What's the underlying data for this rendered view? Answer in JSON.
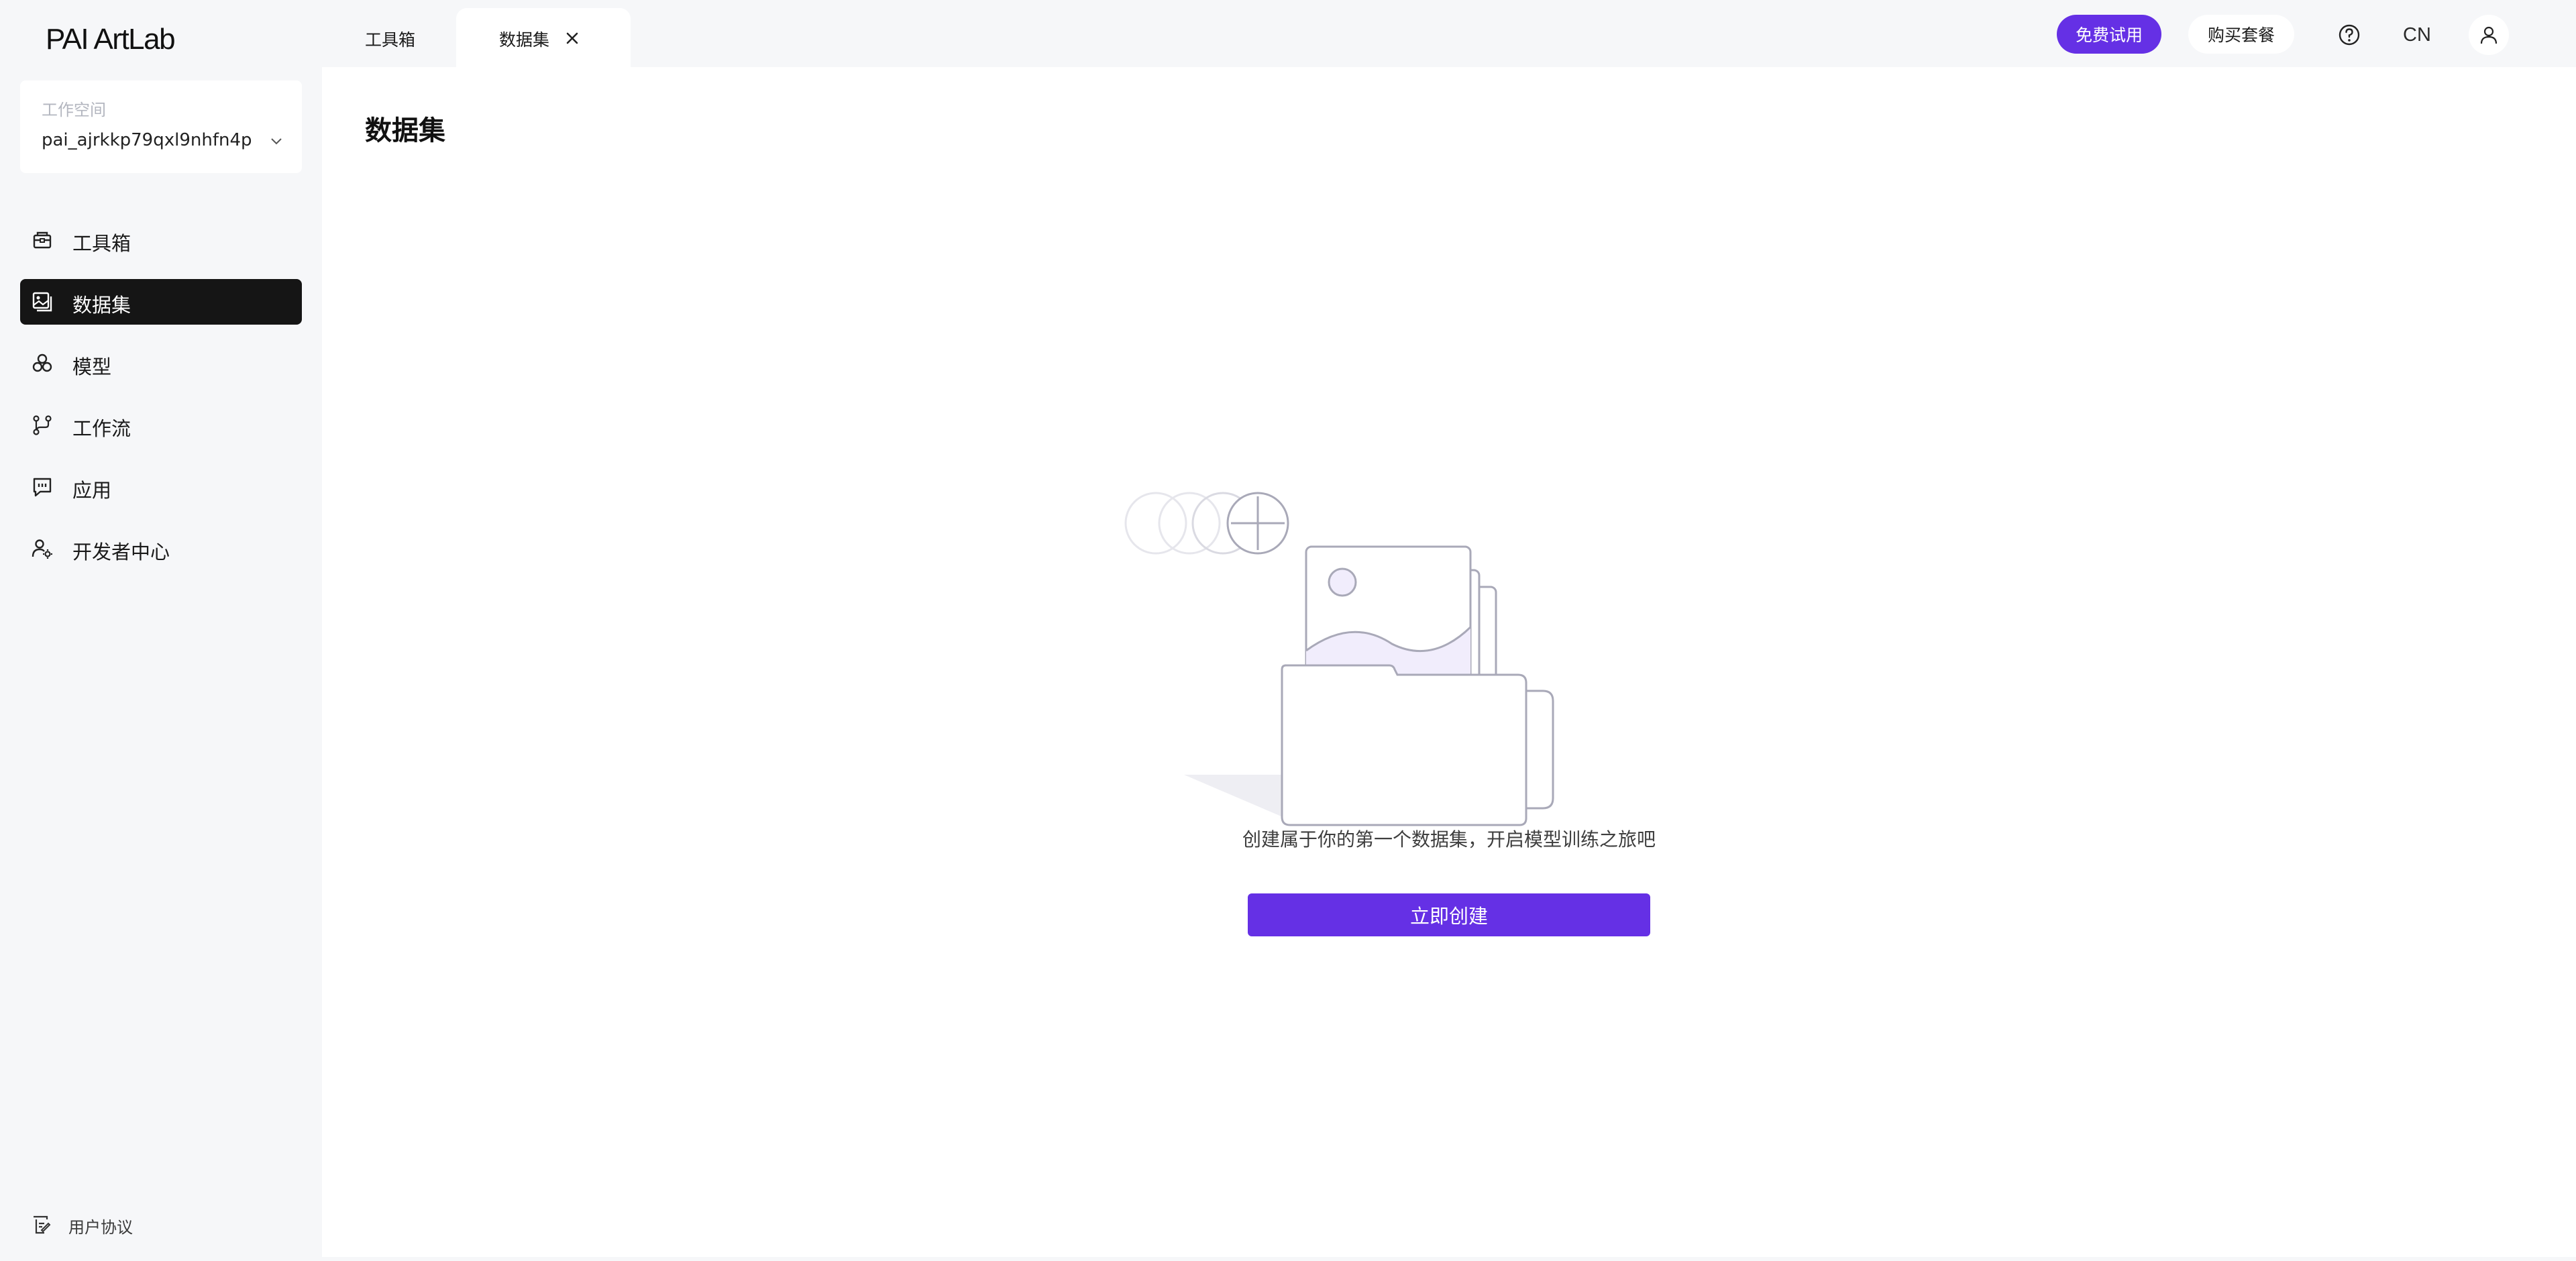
{
  "app": {
    "logo": "PAI ArtLab"
  },
  "workspace": {
    "label": "工作空间",
    "value": "pai_ajrkkp79qxl9nhfn4p"
  },
  "sidebar": {
    "items": [
      {
        "label": "工具箱",
        "icon": "toolbox-icon"
      },
      {
        "label": "数据集",
        "icon": "dataset-icon",
        "active": true
      },
      {
        "label": "模型",
        "icon": "model-icon"
      },
      {
        "label": "工作流",
        "icon": "workflow-icon"
      },
      {
        "label": "应用",
        "icon": "app-icon"
      },
      {
        "label": "开发者中心",
        "icon": "developer-icon"
      }
    ],
    "footer": {
      "label": "用户协议",
      "icon": "agreement-icon"
    }
  },
  "tabs": [
    {
      "label": "工具箱"
    },
    {
      "label": "数据集",
      "active": true,
      "closable": true
    }
  ],
  "header": {
    "trial_label": "免费试用",
    "buy_label": "购买套餐",
    "lang": "CN"
  },
  "main": {
    "title": "数据集",
    "empty_text": "创建属于你的第一个数据集，开启模型训练之旅吧",
    "create_label": "立即创建"
  },
  "colors": {
    "accent": "#6530e5",
    "active_nav": "#151515",
    "page_bg": "#f6f7f9"
  }
}
